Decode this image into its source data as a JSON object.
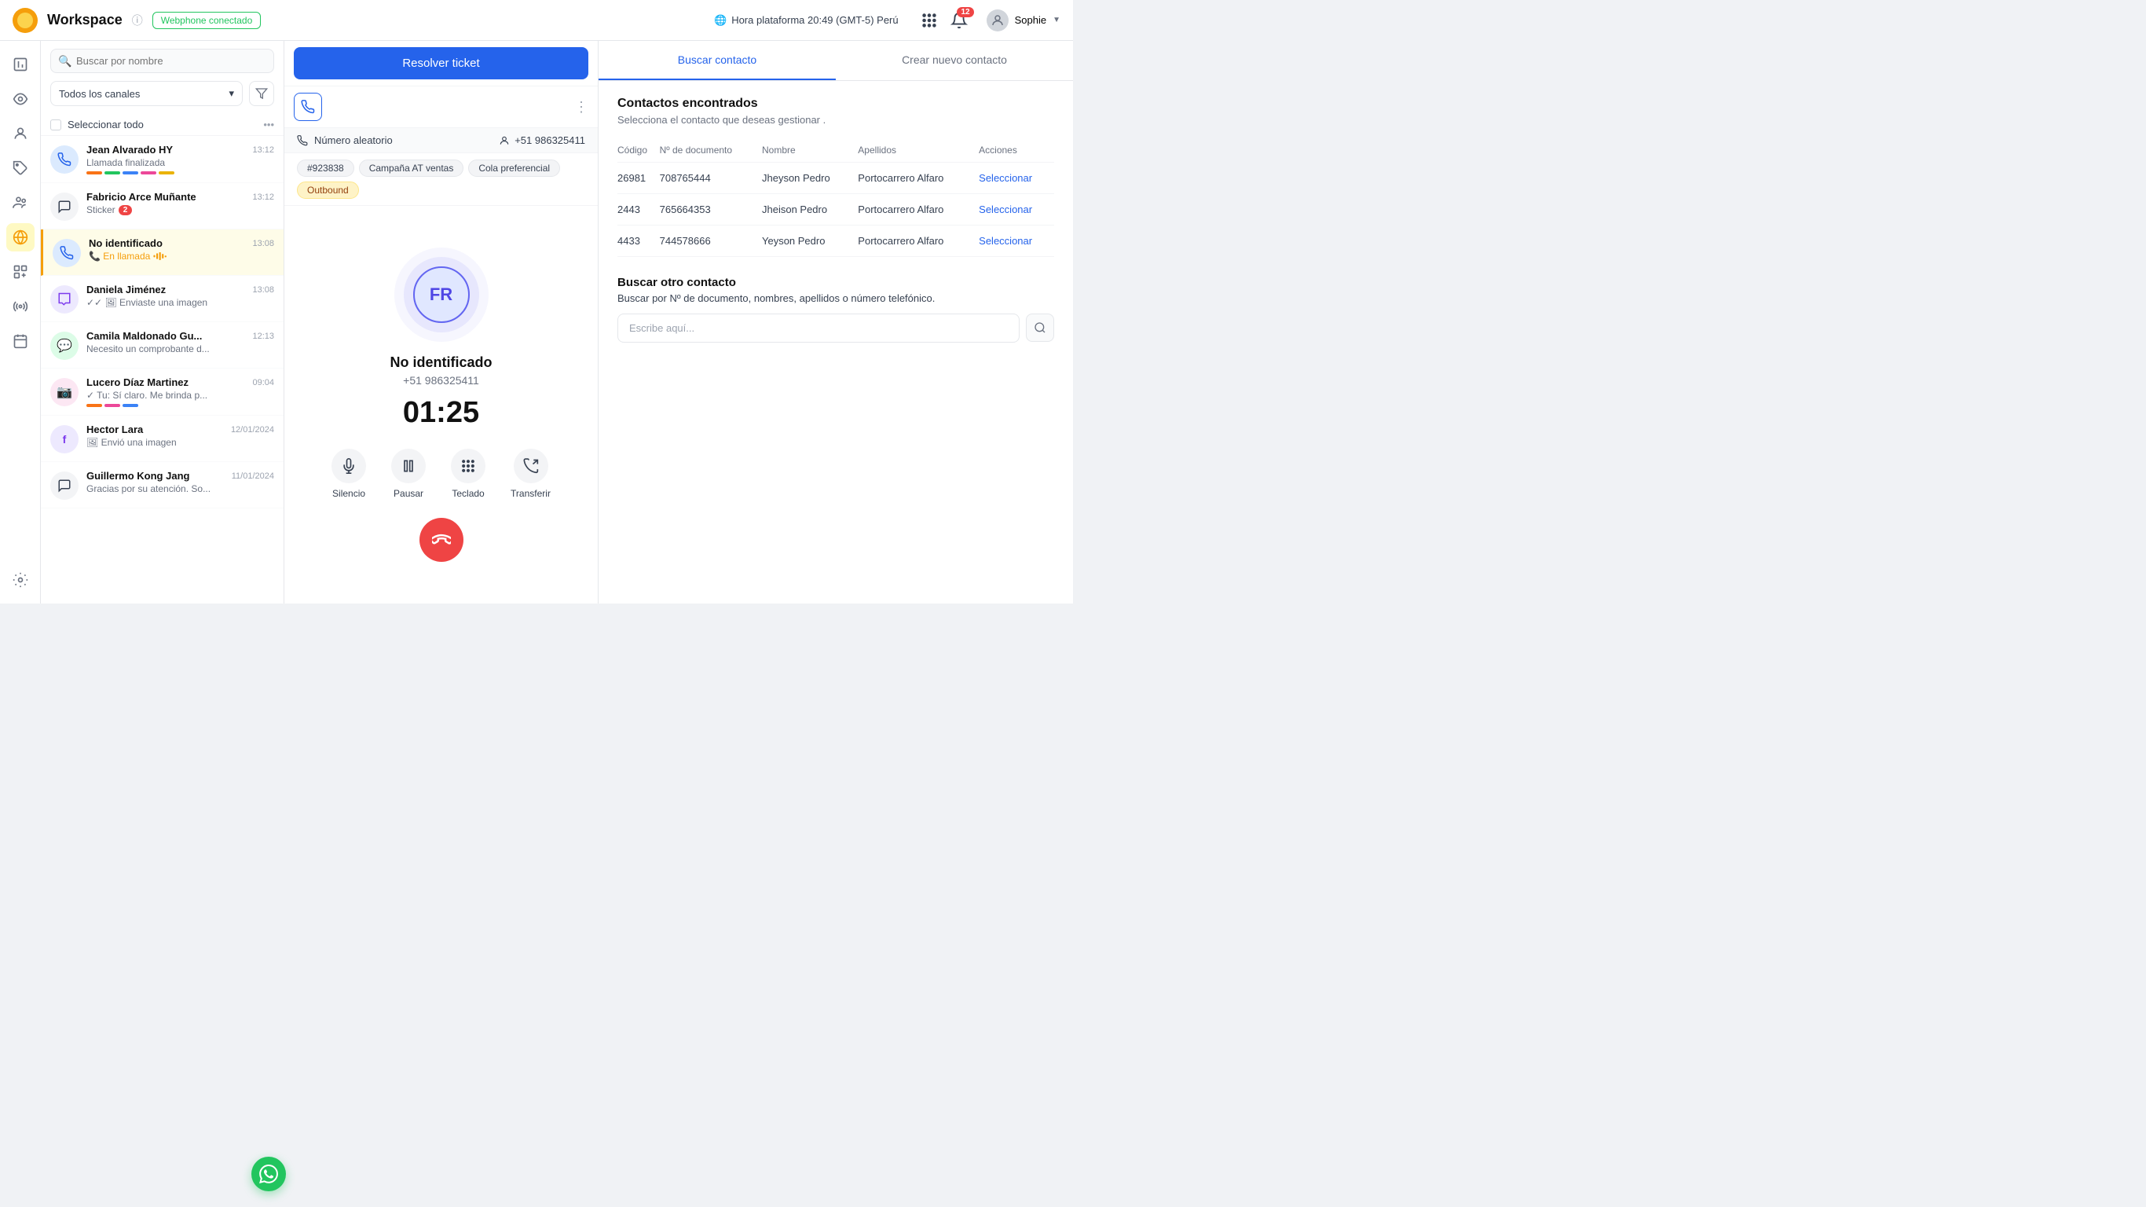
{
  "topbar": {
    "workspace_label": "Workspace",
    "webphone_status": "Webphone conectado",
    "platform_time": "Hora plataforma 20:49 (GMT-5) Perú",
    "notification_count": "12",
    "user_name": "Sophie"
  },
  "sidebar": {
    "icons": [
      "📊",
      "👁️",
      "👤",
      "🏷️",
      "👥",
      "🌐",
      "📅",
      "⚙️"
    ]
  },
  "contact_list": {
    "search_placeholder": "Buscar por nombre",
    "channel_filter": "Todos los canales",
    "select_all_label": "Seleccionar todo",
    "contacts": [
      {
        "name": "Jean Alvarado HY",
        "time": "13:12",
        "preview": "Llamada finalizada",
        "tags": [
          "#f97316",
          "#22c55e",
          "#3b82f6",
          "#ec4899",
          "#eab308"
        ],
        "channel": "phone",
        "badge": ""
      },
      {
        "name": "Fabricio Arce Muñante",
        "time": "13:12",
        "preview": "Sticker",
        "tags": [],
        "channel": "chat",
        "badge": "2"
      },
      {
        "name": "No identificado",
        "time": "13:08",
        "preview": "En llamada",
        "tags": [],
        "channel": "phone",
        "badge": "",
        "active": true
      },
      {
        "name": "Daniela Jiménez",
        "time": "13:08",
        "preview": "✓✓ Enviaste una imagen",
        "tags": [],
        "channel": "messenger",
        "badge": ""
      },
      {
        "name": "Camila Maldonado Gu...",
        "time": "12:13",
        "preview": "Necesito un comprobante d...",
        "tags": [],
        "channel": "whatsapp",
        "badge": ""
      },
      {
        "name": "Lucero Díaz Martinez",
        "time": "09:04",
        "preview": "✓ Tu: Sí claro. Me brinda p...",
        "tags": [
          "#f97316",
          "#ec4899",
          "#3b82f6"
        ],
        "channel": "instagram",
        "badge": ""
      },
      {
        "name": "Hector Lara",
        "time": "12/01/2024",
        "preview": "Envió una imagen",
        "tags": [],
        "channel": "messenger",
        "badge": ""
      },
      {
        "name": "Guillermo Kong Jang",
        "time": "11/01/2024",
        "preview": "Gracias por su atención. So...",
        "tags": [],
        "channel": "chat",
        "badge": ""
      }
    ]
  },
  "call_panel": {
    "resolve_btn_label": "Resolver ticket",
    "number_label": "Número aleatorio",
    "phone_number": "+51 986325411",
    "tag1": "#923838",
    "tag2": "Campaña AT ventas",
    "tag3": "Cola preferencial",
    "tag4": "Outbound",
    "caller_initials": "FR",
    "caller_name": "No identificado",
    "caller_number": "+51 986325411",
    "call_duration": "01:25",
    "actions": [
      {
        "label": "Silencio",
        "icon": "🎤"
      },
      {
        "label": "Pausar",
        "icon": "⏸"
      },
      {
        "label": "Teclado",
        "icon": "⌨️"
      },
      {
        "label": "Transferir",
        "icon": "📞"
      }
    ]
  },
  "right_panel": {
    "tab_search": "Buscar contacto",
    "tab_create": "Crear nuevo contacto",
    "contacts_found_title": "Contactos encontrados",
    "contacts_found_subtitle": "Selecciona el contacto que deseas gestionar .",
    "table_headers": [
      "Código",
      "Nº de documento",
      "Nombre",
      "Apellidos",
      "Acciones"
    ],
    "contacts": [
      {
        "code": "26981",
        "document": "708765444",
        "name": "Jheyson Pedro",
        "surnames": "Portocarrero Alfaro",
        "action": "Seleccionar"
      },
      {
        "code": "2443",
        "document": "765664353",
        "name": "Jheison Pedro",
        "surnames": "Portocarrero Alfaro",
        "action": "Seleccionar"
      },
      {
        "code": "4433",
        "document": "744578666",
        "name": "Yeyson Pedro",
        "surnames": "Portocarrero Alfaro",
        "action": "Seleccionar"
      }
    ],
    "search_other_title": "Buscar otro contacto",
    "search_other_subtitle": "Buscar por  Nº de documento, nombres, apellidos o número telefónico.",
    "search_placeholder": "Escribe aquí..."
  }
}
